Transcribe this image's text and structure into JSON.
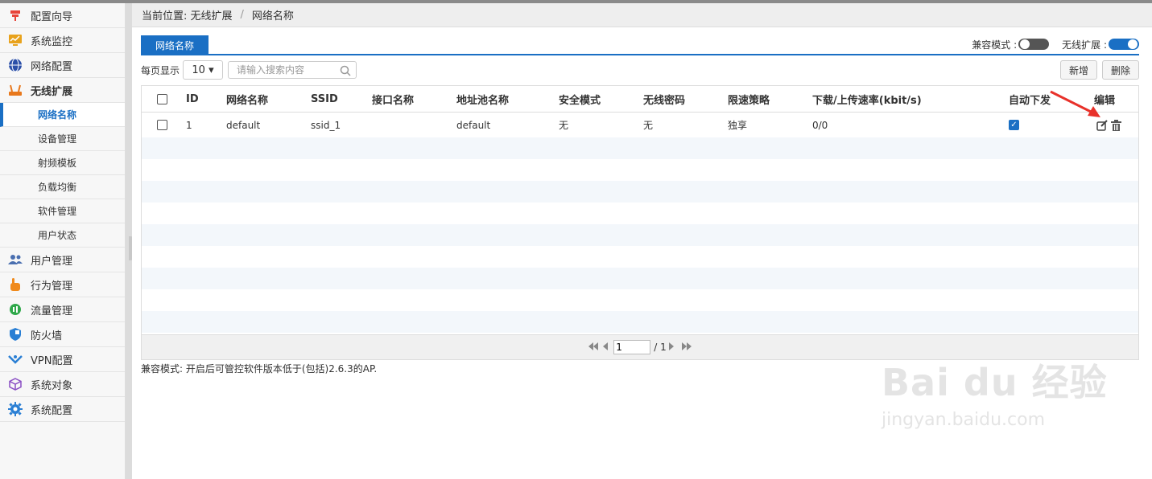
{
  "sidebar": {
    "items": [
      {
        "label": "配置向导",
        "icon": "pin-icon",
        "color": "#e8443a"
      },
      {
        "label": "系统监控",
        "icon": "monitor-icon",
        "color": "#e8a21c"
      },
      {
        "label": "网络配置",
        "icon": "globe-icon",
        "color": "#2b4fa8"
      },
      {
        "label": "无线扩展",
        "icon": "router-icon",
        "color": "#e8781c"
      }
    ],
    "subitems": [
      "网络名称",
      "设备管理",
      "射频模板",
      "负载均衡",
      "软件管理",
      "用户状态"
    ],
    "items_after": [
      {
        "label": "用户管理",
        "icon": "users-icon",
        "color": "#4a6fb0"
      },
      {
        "label": "行为管理",
        "icon": "hand-icon",
        "color": "#f08a1c"
      },
      {
        "label": "流量管理",
        "icon": "traffic-icon",
        "color": "#2fa84a"
      },
      {
        "label": "防火墙",
        "icon": "shield-icon",
        "color": "#2a7fd4"
      },
      {
        "label": "VPN配置",
        "icon": "vpn-icon",
        "color": "#2a7fd4"
      },
      {
        "label": "系统对象",
        "icon": "cube-icon",
        "color": "#8a4fc4"
      },
      {
        "label": "系统配置",
        "icon": "gear-icon",
        "color": "#2a7fd4"
      }
    ]
  },
  "breadcrumb": {
    "prefix": "当前位置: 无线扩展",
    "sep": "/",
    "current": "网络名称"
  },
  "tab": {
    "label": "网络名称"
  },
  "toggles": {
    "compat_label": "兼容模式 :",
    "wireless_label": "无线扩展 :"
  },
  "controls": {
    "per_page_label": "每页显示",
    "per_page_value": "10 ▾",
    "search_placeholder": "请输入搜索内容",
    "add_label": "新增",
    "delete_label": "删除"
  },
  "table": {
    "headers": [
      "ID",
      "网络名称",
      "SSID",
      "接口名称",
      "地址池名称",
      "安全模式",
      "无线密码",
      "限速策略",
      "下载/上传速率(kbit/s)",
      "自动下发",
      "编辑"
    ],
    "rows": [
      {
        "id": "1",
        "name": "default",
        "ssid": "ssid_1",
        "iface": "",
        "pool": "default",
        "security": "无",
        "password": "无",
        "limit": "独享",
        "rate": "0/0",
        "auto": true
      }
    ]
  },
  "pager": {
    "page": "1",
    "total": "/ 1"
  },
  "note": "兼容模式: 开启后可管控软件版本低于(包括)2.6.3的AP.",
  "watermark": {
    "line1": "Bai du 经验",
    "line2": "jingyan.baidu.com"
  },
  "colors": {
    "accent": "#1a6fc4",
    "arrow": "#e8312a"
  }
}
